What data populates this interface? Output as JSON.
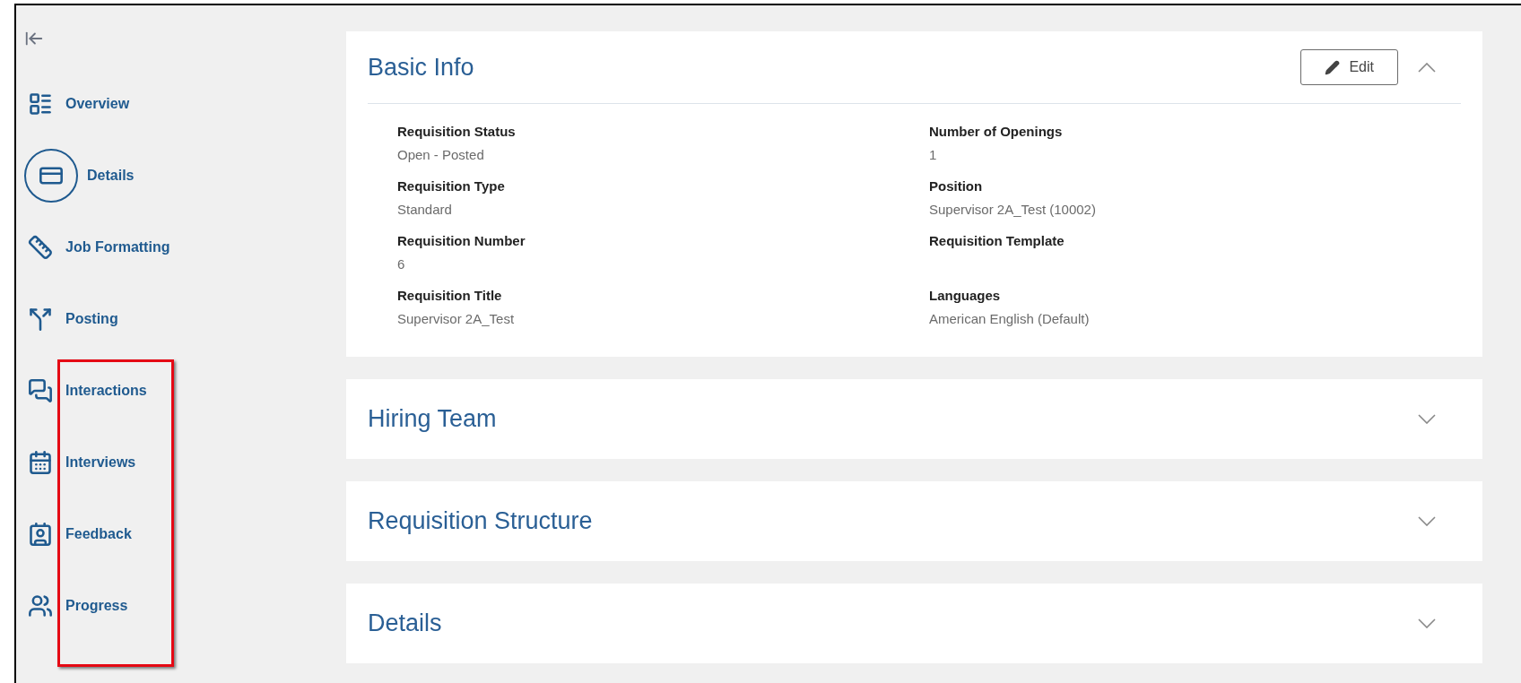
{
  "sidebar": {
    "collapse_button": {
      "kind": "collapse"
    },
    "items": [
      {
        "label": "Overview",
        "selected": false,
        "highlighted": false
      },
      {
        "label": "Details",
        "selected": true,
        "highlighted": false
      },
      {
        "label": "Job Formatting",
        "selected": false,
        "highlighted": false
      },
      {
        "label": "Posting",
        "selected": false,
        "highlighted": false
      },
      {
        "label": "Interactions",
        "selected": false,
        "highlighted": true
      },
      {
        "label": "Interviews",
        "selected": false,
        "highlighted": true
      },
      {
        "label": "Feedback",
        "selected": false,
        "highlighted": true
      },
      {
        "label": "Progress",
        "selected": false,
        "highlighted": true
      }
    ]
  },
  "sections": [
    {
      "title": "Basic Info",
      "expanded": true,
      "edit_button": "Edit",
      "fields": [
        {
          "label": "Requisition Status",
          "value": "Open - Posted"
        },
        {
          "label": "Number of Openings",
          "value": "1"
        },
        {
          "label": "Requisition Type",
          "value": "Standard"
        },
        {
          "label": "Position",
          "value": "Supervisor 2A_Test (10002)"
        },
        {
          "label": "Requisition Number",
          "value": "6"
        },
        {
          "label": "Requisition Template"
        },
        {
          "label": "Requisition Title",
          "value": "Supervisor 2A_Test"
        },
        {
          "label": "Languages",
          "value": "American English (Default)"
        }
      ]
    },
    {
      "title": "Hiring Team",
      "expanded": false
    },
    {
      "title": "Requisition Structure",
      "expanded": false
    },
    {
      "title": "Details",
      "expanded": false
    }
  ]
}
